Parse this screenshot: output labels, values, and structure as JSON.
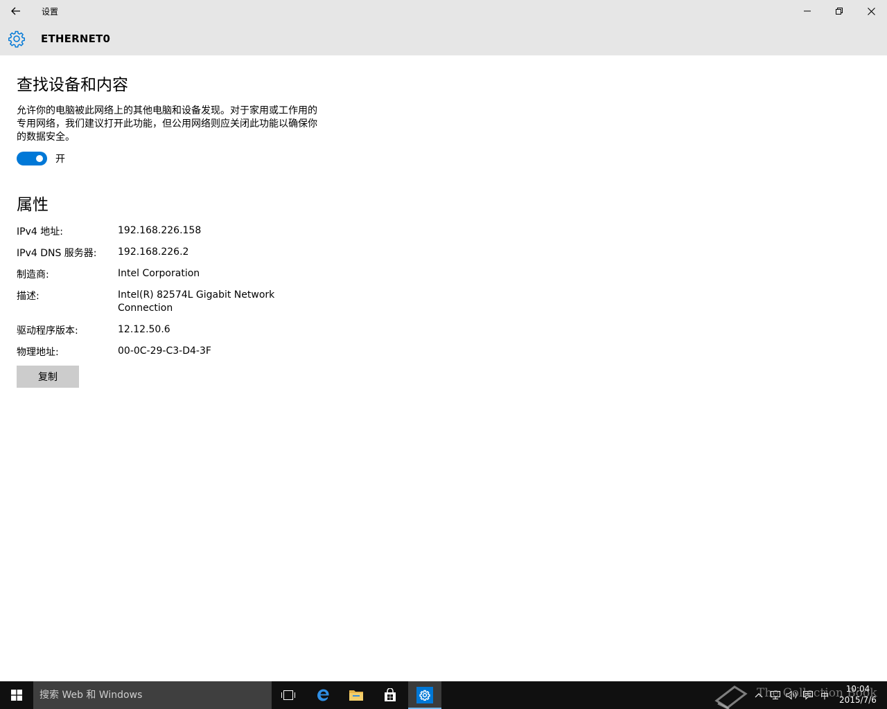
{
  "window": {
    "title": "设置",
    "back_icon": "back-arrow-icon",
    "minimize_icon": "minimize-icon",
    "restore_icon": "restore-icon",
    "close_icon": "close-icon"
  },
  "header": {
    "icon": "gear-icon",
    "title": "ETHERNET0"
  },
  "discovery": {
    "heading": "查找设备和内容",
    "description": "允许你的电脑被此网络上的其他电脑和设备发现。对于家用或工作用的专用网络，我们建议打开此功能，但公用网络则应关闭此功能以确保你的数据安全。",
    "toggle_state": "on",
    "toggle_label": "开"
  },
  "properties": {
    "heading": "属性",
    "rows": [
      {
        "label": "IPv4 地址:",
        "value": "192.168.226.158"
      },
      {
        "label": "IPv4 DNS 服务器:",
        "value": "192.168.226.2"
      },
      {
        "label": "制造商:",
        "value": "Intel Corporation"
      },
      {
        "label": "描述:",
        "value": "Intel(R) 82574L Gigabit Network Connection"
      },
      {
        "label": "驱动程序版本:",
        "value": "12.12.50.6"
      },
      {
        "label": "物理地址:",
        "value": "00-0C-29-C3-D4-3F"
      }
    ],
    "copy_label": "复制"
  },
  "taskbar": {
    "search_placeholder": "搜索 Web 和 Windows",
    "apps": [
      "task-view-icon",
      "edge-icon",
      "file-explorer-icon",
      "store-icon",
      "settings-icon"
    ],
    "tray": {
      "ime": "中",
      "time": "10:04",
      "date": "2015/7/6"
    },
    "watermark": "The Collection Book"
  },
  "colors": {
    "accent": "#0078d7",
    "chrome": "#e6e6e6",
    "taskbar": "#101010",
    "search_box": "#3f3f3f"
  }
}
